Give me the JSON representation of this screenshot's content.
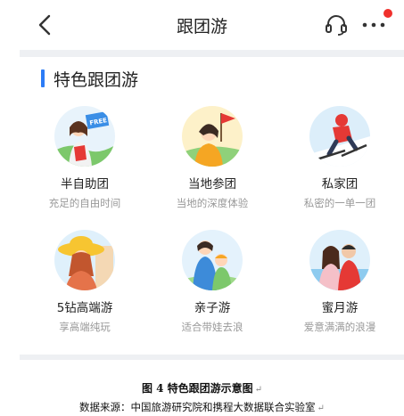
{
  "header": {
    "title": "跟团游",
    "back_icon": "chevron-left-icon",
    "service_icon": "headset-icon",
    "more_icon": "more-dots-icon",
    "notification_color": "#f0302c"
  },
  "section": {
    "title": "特色跟团游",
    "accent_color": "#2c7cf6",
    "items": [
      {
        "label": "半自助团",
        "sub": "充足的自由时间",
        "icon": "free-flag-icon",
        "badge": "FREE"
      },
      {
        "label": "当地参团",
        "sub": "当地的深度体验",
        "icon": "local-flag-icon"
      },
      {
        "label": "私家团",
        "sub": "私密的一单一团",
        "icon": "skier-icon"
      },
      {
        "label": "5钻高端游",
        "sub": "享高端纯玩",
        "icon": "sunhat-icon"
      },
      {
        "label": "亲子游",
        "sub": "适合带娃去浪",
        "icon": "parent-child-icon"
      },
      {
        "label": "蜜月游",
        "sub": "爱意满满的浪漫",
        "icon": "couple-icon"
      }
    ]
  },
  "caption": {
    "title": "图 4  特色跟团游示意图",
    "source": "数据来源：中国旅游研究院和携程大数据联合实验室"
  }
}
